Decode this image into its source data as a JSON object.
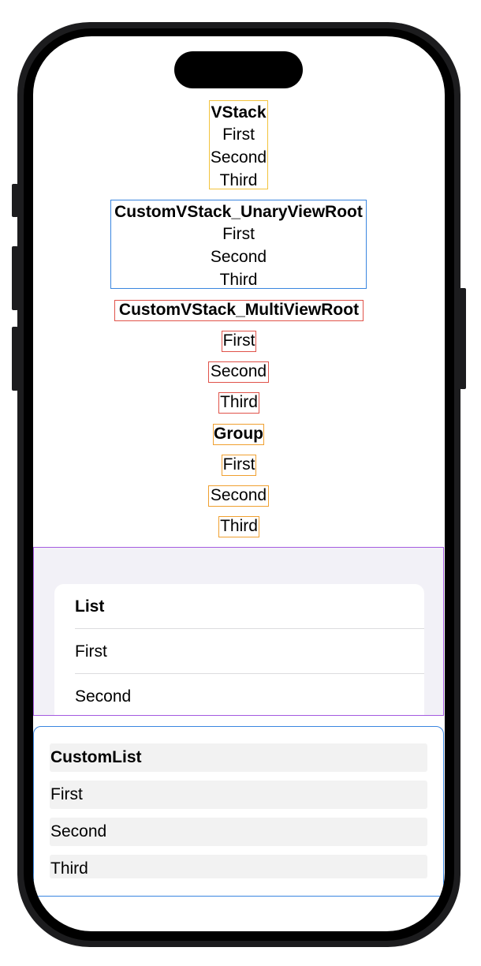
{
  "vstack": {
    "title": "VStack",
    "items": [
      "First",
      "Second",
      "Third"
    ]
  },
  "unary": {
    "title": "CustomVStack_UnaryViewRoot",
    "items": [
      "First",
      "Second",
      "Third"
    ]
  },
  "multi": {
    "title": "CustomVStack_MultiViewRoot",
    "items": [
      "First",
      "Second",
      "Third"
    ]
  },
  "group": {
    "title": "Group",
    "items": [
      "First",
      "Second",
      "Third"
    ]
  },
  "list": {
    "title": "List",
    "items": [
      "First",
      "Second"
    ]
  },
  "custom_list": {
    "title": "CustomList",
    "items": [
      "First",
      "Second",
      "Third"
    ]
  },
  "colors": {
    "vstack_border": "#f3c33c",
    "unary_border": "#3a86e0",
    "multi_border": "#e0534a",
    "group_border": "#f0a030",
    "list_border": "#a45be0",
    "list_background": "#f2f1f7",
    "custom_list_border": "#3a86e0",
    "custom_list_row_background": "#f2f2f2"
  }
}
